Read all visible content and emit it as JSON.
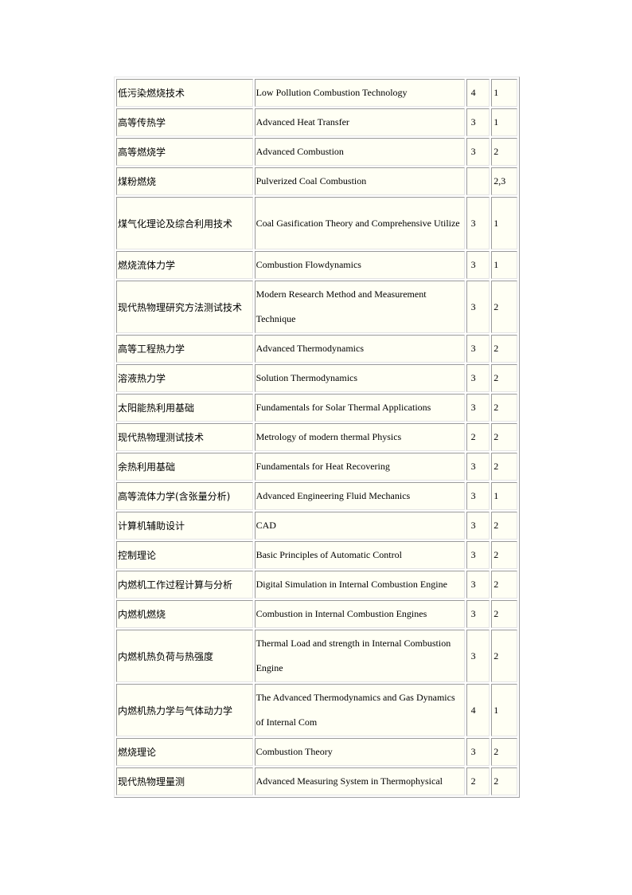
{
  "courses": [
    {
      "cn": "低污染燃烧技术",
      "en": "Low Pollution Combustion Technology",
      "credits": "4",
      "semester": "1",
      "lines": 1
    },
    {
      "cn": "高等传热学",
      "en": "Advanced Heat Transfer",
      "credits": "3",
      "semester": "1",
      "lines": 1
    },
    {
      "cn": "高等燃烧学",
      "en": "Advanced Combustion",
      "credits": "3",
      "semester": "2",
      "lines": 1
    },
    {
      "cn": "煤粉燃烧",
      "en": "Pulverized Coal Combustion",
      "credits": "",
      "semester": "2,3",
      "lines": 1
    },
    {
      "cn": "煤气化理论及综合利用技术",
      "en": "Coal Gasification Theory and Comprehensive Utilize",
      "credits": "3",
      "semester": "1",
      "lines": 2
    },
    {
      "cn": "燃烧流体力学",
      "en": "Combustion Flowdynamics",
      "credits": "3",
      "semester": "1",
      "lines": 1
    },
    {
      "cn": "现代热物理研究方法测试技术",
      "en": "Modern Research Method and Measurement Technique",
      "credits": "3",
      "semester": "2",
      "lines": 2
    },
    {
      "cn": "高等工程热力学",
      "en": "Advanced Thermodynamics",
      "credits": "3",
      "semester": "2",
      "lines": 1
    },
    {
      "cn": "溶液热力学",
      "en": "Solution Thermodynamics",
      "credits": "3",
      "semester": "2",
      "lines": 1
    },
    {
      "cn": "太阳能热利用基础",
      "en": "Fundamentals for Solar Thermal Applications",
      "credits": "3",
      "semester": "2",
      "lines": 1
    },
    {
      "cn": "现代热物理测试技术",
      "en": "Metrology of modern thermal Physics",
      "credits": "2",
      "semester": "2",
      "lines": 1
    },
    {
      "cn": "余热利用基础",
      "en": "Fundamentals for Heat Recovering",
      "credits": "3",
      "semester": "2",
      "lines": 1
    },
    {
      "cn": "高等流体力学(含张量分析)",
      "en": "Advanced Engineering Fluid Mechanics",
      "credits": "3",
      "semester": "1",
      "lines": 1
    },
    {
      "cn": "计算机辅助设计",
      "en": "CAD",
      "credits": "3",
      "semester": "2",
      "lines": 1
    },
    {
      "cn": "控制理论",
      "en": "Basic Principles of Automatic Control",
      "credits": "3",
      "semester": "2",
      "lines": 1
    },
    {
      "cn": "内燃机工作过程计算与分析",
      "en": "Digital Simulation in Internal Combustion Engine",
      "credits": "3",
      "semester": "2",
      "lines": 1
    },
    {
      "cn": "内燃机燃烧",
      "en": "Combustion in Internal Combustion Engines",
      "credits": "3",
      "semester": "2",
      "lines": 1
    },
    {
      "cn": "内燃机热负荷与热强度",
      "en": "Thermal Load and strength in Internal Combustion Engine",
      "credits": "3",
      "semester": "2",
      "lines": 2
    },
    {
      "cn": "内燃机热力学与气体动力学",
      "en": "The Advanced Thermodynamics and Gas Dynamics of Internal Com",
      "credits": "4",
      "semester": "1",
      "lines": 2
    },
    {
      "cn": "燃烧理论",
      "en": "Combustion Theory",
      "credits": "3",
      "semester": "2",
      "lines": 1
    },
    {
      "cn": "现代热物理量测",
      "en": "Advanced Measuring System in Thermophysical",
      "credits": "2",
      "semester": "2",
      "lines": 1
    }
  ]
}
